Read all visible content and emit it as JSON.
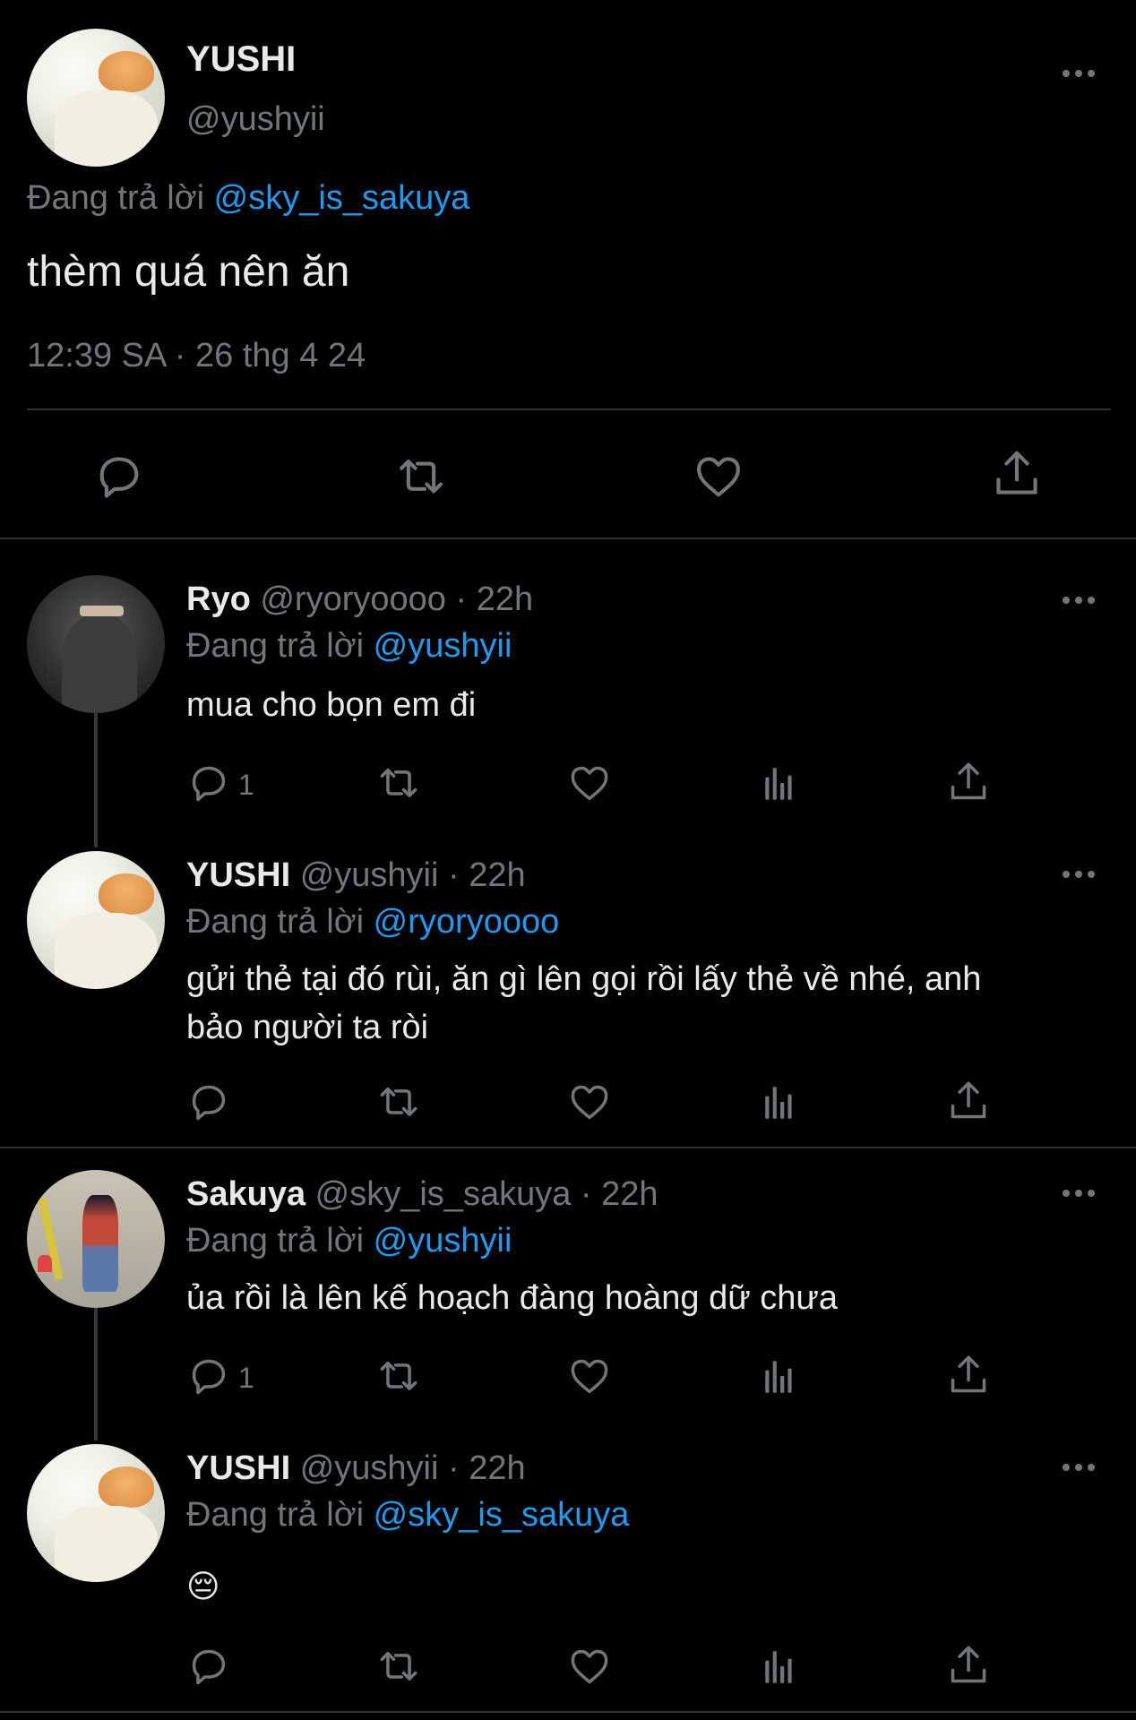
{
  "main_tweet": {
    "name": "YUSHI",
    "handle": "@yushyii",
    "replying_prefix": "Đang trả lời",
    "replying_to": "@sky_is_sakuya",
    "text": "thèm quá nên ăn",
    "timestamp": "12:39 SA · 26 thg 4 24"
  },
  "replies": [
    {
      "name": "Ryo",
      "handle": "@ryoryoooo",
      "time": "· 22h",
      "replying_prefix": "Đang trả lời",
      "replying_to": "@yushyii",
      "text": "mua cho bọn em đi",
      "reply_count": "1"
    },
    {
      "name": "YUSHI",
      "handle": "@yushyii",
      "time": "· 22h",
      "replying_prefix": "Đang trả lời",
      "replying_to": "@ryoryoooo",
      "text_line1": "gửi thẻ tại đó rùi, ăn gì lên gọi rồi lấy thẻ về nhé, anh",
      "text_line2": "bảo người ta ròi"
    },
    {
      "name": "Sakuya",
      "handle": "@sky_is_sakuya",
      "time": "· 22h",
      "replying_prefix": "Đang trả lời",
      "replying_to": "@yushyii",
      "text": "ủa rồi là lên kế hoạch đàng hoàng dữ chưa",
      "reply_count": "1"
    },
    {
      "name": "YUSHI",
      "handle": "@yushyii",
      "time": "· 22h",
      "replying_prefix": "Đang trả lời",
      "replying_to": "@sky_is_sakuya",
      "text": "😔"
    }
  ],
  "icons": {
    "reply": "reply-icon",
    "retweet": "retweet-icon",
    "like": "heart-icon",
    "views": "views-icon",
    "share": "share-icon",
    "more": "more-icon"
  },
  "colors": {
    "background": "#000000",
    "text": "#e7e9ea",
    "secondary": "#71767b",
    "link": "#1d9bf0",
    "divider": "#2f3336"
  }
}
